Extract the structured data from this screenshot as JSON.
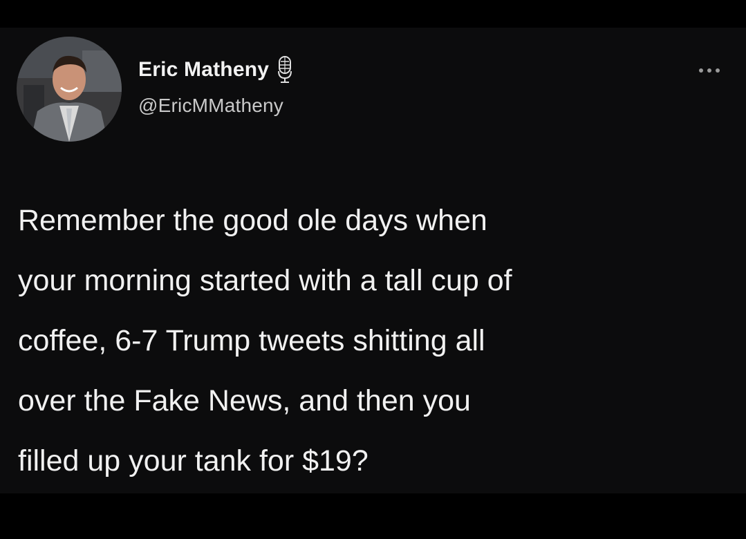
{
  "tweet": {
    "author": {
      "display_name": "Eric Matheny",
      "handle": "@EricMMatheny",
      "badge_icon": "microphone-icon",
      "avatar_icon": "profile-photo"
    },
    "menu_icon": "more-dots-icon",
    "text_lines": [
      "Remember the good ole days when",
      "your morning started with a tall cup of",
      "coffee, 6-7 Trump tweets shitting all",
      "over the Fake News, and then you",
      "filled up your tank for $19?"
    ]
  },
  "colors": {
    "background": "#000000",
    "card": "#0c0c0d",
    "text": "#f1f1f1",
    "secondary_text": "#c9c9c9"
  }
}
